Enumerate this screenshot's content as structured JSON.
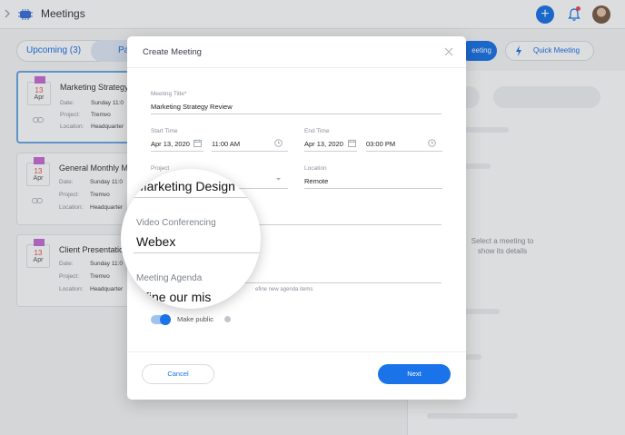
{
  "app": {
    "title": "Meetings"
  },
  "tabs": {
    "upcoming": "Upcoming (3)",
    "past_partial": "Pa"
  },
  "header_buttons": {
    "meeting_partial": "eeting",
    "quick_meeting": "Quick Meeting"
  },
  "meeting_cards": [
    {
      "day": "13",
      "month": "Apr",
      "title": "Marketing Strategy",
      "date_label": "Date:",
      "date_value": "Sunday 11:0",
      "project_label": "Project:",
      "project_value": "Tremvo",
      "location_label": "Location:",
      "location_value": "Headquarter"
    },
    {
      "day": "13",
      "month": "Apr",
      "title": "General Monthly Me",
      "date_label": "Date:",
      "date_value": "Sunday 11:0",
      "project_label": "Project:",
      "project_value": "Tremvo",
      "location_label": "Location:",
      "location_value": "Headquarter"
    },
    {
      "day": "13",
      "month": "Apr",
      "title": "Client Presentation",
      "date_label": "Date:",
      "date_value": "Sunday 11:0",
      "project_label": "Project:",
      "project_value": "Tremvo",
      "location_label": "Location:",
      "location_value": "Headquarter"
    }
  ],
  "right_panel": {
    "empty_text": "Select a meeting to show its details"
  },
  "modal": {
    "title": "Create Meeting",
    "meeting_title_label": "Meeting Title*",
    "meeting_title_value": "Marketing Strategy Review",
    "start_time_label": "Start Time",
    "start_date": "Apr 13, 2020",
    "start_time": "11:00 AM",
    "end_time_label": "End Time",
    "end_date": "Apr 13, 2020",
    "end_time": "03:00 PM",
    "project_label": "Project",
    "location_label": "Location",
    "location_value": "Remote",
    "participants_partial": "s",
    "agenda_hint": "efine new agenda items",
    "make_public_label": "Make public",
    "cancel_label": "Cancel",
    "next_label": "Next"
  },
  "magnifier": {
    "project_value": "Marketing Design",
    "video_label": "Video Conferencing",
    "video_value": "Webex",
    "agenda_label": "Meeting Agenda",
    "agenda_value": "fine our mis"
  },
  "colors": {
    "accent": "#1a73e8",
    "calendar_flag": "#c86ed5",
    "notification_dot": "#e94c5c"
  }
}
